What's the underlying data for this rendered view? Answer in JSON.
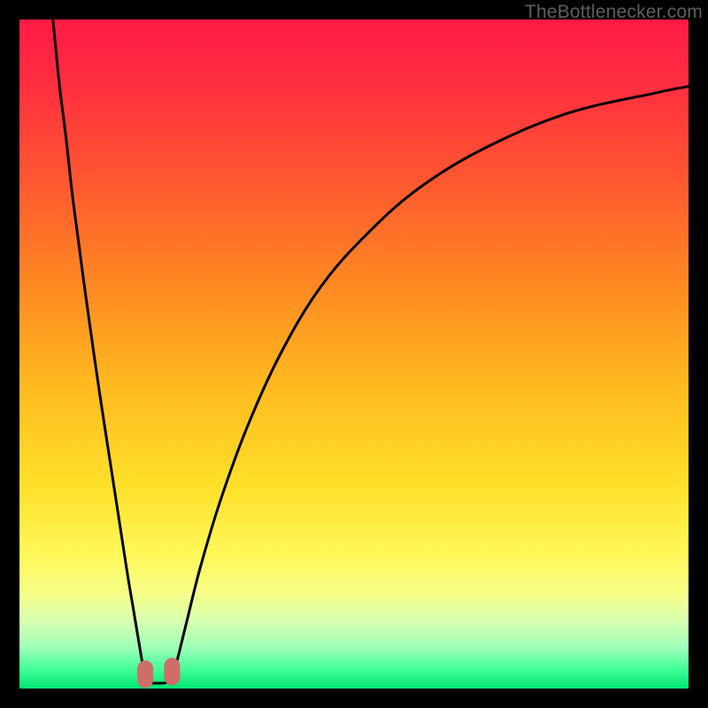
{
  "watermark": "TheBottlenecker.com",
  "colors": {
    "gradient_stops": [
      {
        "offset": 0.0,
        "color": "#ff1a47"
      },
      {
        "offset": 0.1,
        "color": "#ff2f3f"
      },
      {
        "offset": 0.25,
        "color": "#ff5a2f"
      },
      {
        "offset": 0.4,
        "color": "#ff8a22"
      },
      {
        "offset": 0.55,
        "color": "#ffba1f"
      },
      {
        "offset": 0.7,
        "color": "#ffe12a"
      },
      {
        "offset": 0.8,
        "color": "#fff85a"
      },
      {
        "offset": 0.86,
        "color": "#f5ff8a"
      },
      {
        "offset": 0.9,
        "color": "#d6ffb1"
      },
      {
        "offset": 0.94,
        "color": "#9cffb8"
      },
      {
        "offset": 0.97,
        "color": "#45ff9a"
      },
      {
        "offset": 1.0,
        "color": "#00e673"
      }
    ],
    "curve": "#000000",
    "marker": "#cf6d6a"
  },
  "chart_data": {
    "type": "line",
    "title": "",
    "xlabel": "",
    "ylabel": "",
    "xlim": [
      0,
      100
    ],
    "ylim": [
      0,
      100
    ],
    "series": [
      {
        "name": "left-curve",
        "x": [
          5,
          6,
          7,
          8,
          10,
          12,
          14,
          16,
          17,
          18,
          18.6,
          19.0
        ],
        "y": [
          100,
          90,
          82,
          73,
          58,
          44,
          31,
          18,
          12,
          6,
          2.5,
          1.0
        ]
      },
      {
        "name": "right-curve",
        "x": [
          22.5,
          23.5,
          25,
          27,
          30,
          34,
          39,
          45,
          52,
          60,
          70,
          82,
          95,
          100
        ],
        "y": [
          1.0,
          4,
          10,
          18,
          28,
          39,
          50,
          60,
          68,
          75,
          81,
          86,
          89,
          90
        ]
      },
      {
        "name": "bottom-connector",
        "x": [
          19.0,
          19.5,
          20.2,
          21.3,
          22.0,
          22.5
        ],
        "y": [
          1.0,
          0.8,
          0.8,
          0.8,
          0.9,
          1.0
        ]
      }
    ],
    "markers": [
      {
        "name": "marker-left",
        "x": 18.8,
        "y": 2.2
      },
      {
        "name": "marker-right",
        "x": 22.8,
        "y": 2.6
      }
    ]
  }
}
